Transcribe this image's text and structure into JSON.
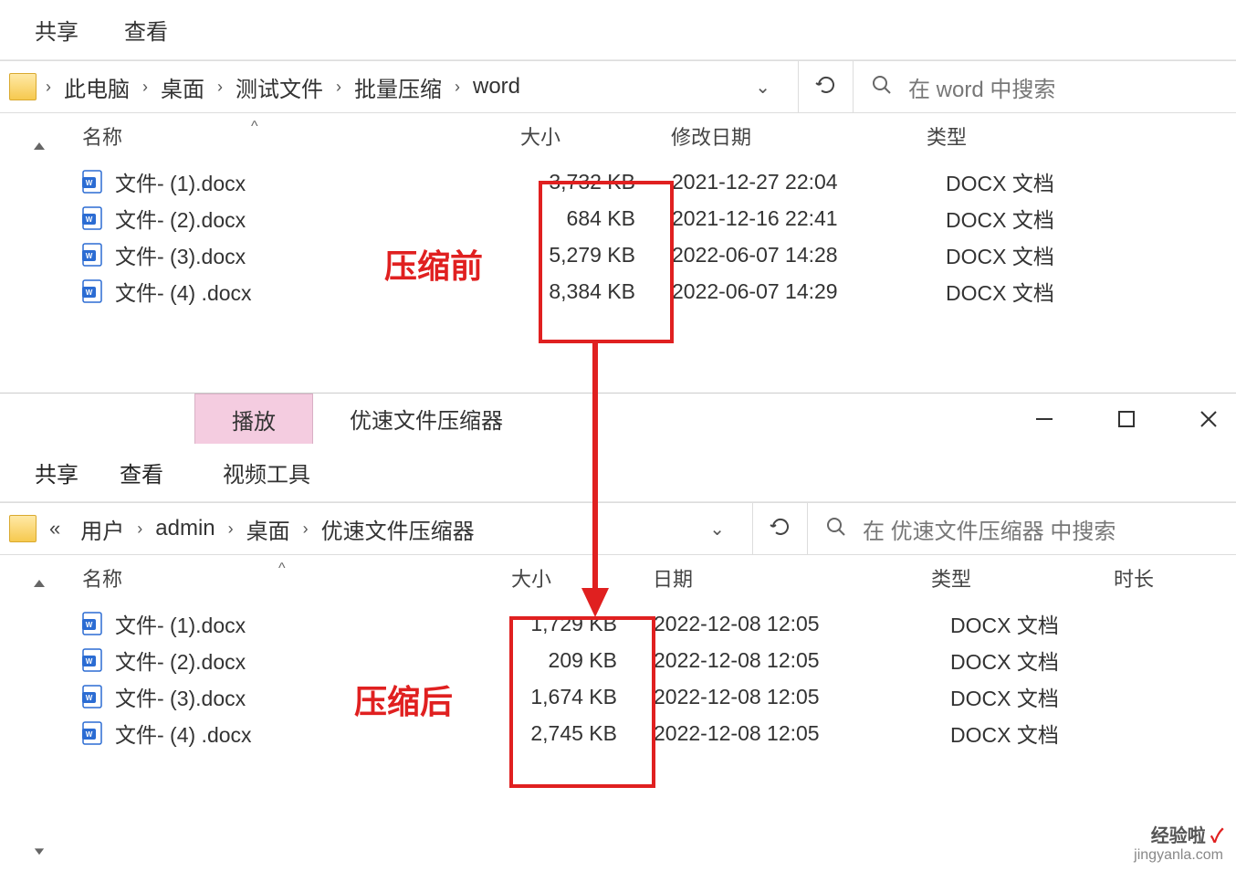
{
  "window1": {
    "ribbon": {
      "share": "共享",
      "view": "查看"
    },
    "breadcrumb": [
      "此电脑",
      "桌面",
      "测试文件",
      "批量压缩",
      "word"
    ],
    "search_placeholder": "在 word 中搜索",
    "columns": {
      "name": "名称",
      "size": "大小",
      "date": "修改日期",
      "type": "类型"
    },
    "files": [
      {
        "name": "文件- (1).docx",
        "size": "3,732 KB",
        "date": "2021-12-27 22:04",
        "type": "DOCX 文档"
      },
      {
        "name": "文件- (2).docx",
        "size": "684 KB",
        "date": "2021-12-16 22:41",
        "type": "DOCX 文档"
      },
      {
        "name": "文件- (3).docx",
        "size": "5,279 KB",
        "date": "2022-06-07 14:28",
        "type": "DOCX 文档"
      },
      {
        "name": "文件- (4) .docx",
        "size": "8,384 KB",
        "date": "2022-06-07 14:29",
        "type": "DOCX 文档"
      }
    ]
  },
  "window2": {
    "titlebar": {
      "play": "播放",
      "title": "优速文件压缩器"
    },
    "ribbon": {
      "share": "共享",
      "view": "查看",
      "video_tools": "视频工具"
    },
    "breadcrumb": [
      "用户",
      "admin",
      "桌面",
      "优速文件压缩器"
    ],
    "search_placeholder": "在 优速文件压缩器 中搜索",
    "columns": {
      "name": "名称",
      "size": "大小",
      "date": "日期",
      "type": "类型",
      "duration": "时长"
    },
    "files": [
      {
        "name": "文件- (1).docx",
        "size": "1,729 KB",
        "date": "2022-12-08 12:05",
        "type": "DOCX 文档"
      },
      {
        "name": "文件- (2).docx",
        "size": "209 KB",
        "date": "2022-12-08 12:05",
        "type": "DOCX 文档"
      },
      {
        "name": "文件- (3).docx",
        "size": "1,674 KB",
        "date": "2022-12-08 12:05",
        "type": "DOCX 文档"
      },
      {
        "name": "文件- (4) .docx",
        "size": "2,745 KB",
        "date": "2022-12-08 12:05",
        "type": "DOCX 文档"
      }
    ]
  },
  "annotations": {
    "before": "压缩前",
    "after": "压缩后"
  },
  "watermark": {
    "brand": "经验啦",
    "url": "jingyanla.com"
  }
}
